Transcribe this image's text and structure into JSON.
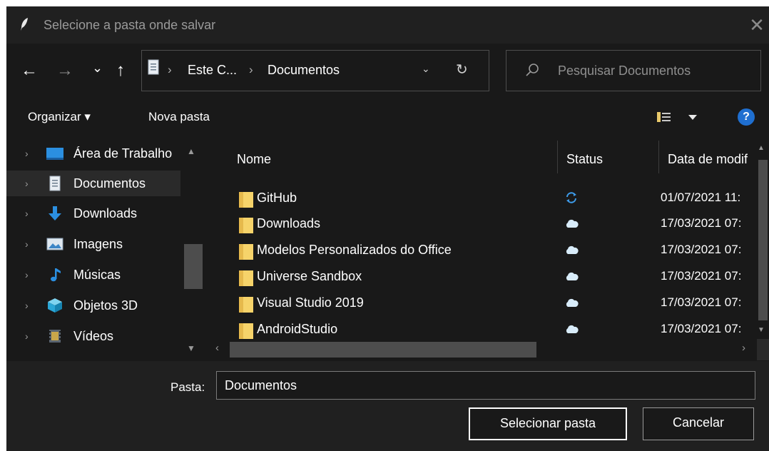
{
  "window": {
    "title": "Selecione a pasta onde salvar",
    "close_icon": "✕"
  },
  "nav": {
    "back_icon": "←",
    "forward_icon": "→",
    "recent_icon": "⌄",
    "up_icon": "↑"
  },
  "address": {
    "crumbs": [
      "Este C...",
      "Documentos"
    ],
    "separator": "›",
    "dropdown_icon": "⌄",
    "refresh_icon": "↻"
  },
  "search": {
    "placeholder": "Pesquisar Documentos"
  },
  "commandbar": {
    "organize_label": "Organizar ▾",
    "new_folder_label": "Nova pasta",
    "help_label": "?"
  },
  "navigation_pane": {
    "items": [
      {
        "label": "Área de Trabalho",
        "icon": "desktop-icon",
        "selected": false
      },
      {
        "label": "Documentos",
        "icon": "documents-icon",
        "selected": true
      },
      {
        "label": "Downloads",
        "icon": "downloads-icon",
        "selected": false
      },
      {
        "label": "Imagens",
        "icon": "pictures-icon",
        "selected": false
      },
      {
        "label": "Músicas",
        "icon": "music-icon",
        "selected": false
      },
      {
        "label": "Objetos 3D",
        "icon": "3d-objects-icon",
        "selected": false
      },
      {
        "label": "Vídeos",
        "icon": "videos-icon",
        "selected": false
      }
    ]
  },
  "file_list": {
    "columns": [
      "Nome",
      "Status",
      "Data de modif"
    ],
    "rows": [
      {
        "name": "GitHub",
        "status": "sync-icon",
        "date": "01/07/2021 11:"
      },
      {
        "name": "Downloads",
        "status": "cloud-icon",
        "date": "17/03/2021 07:"
      },
      {
        "name": "Modelos Personalizados do Office",
        "status": "cloud-icon",
        "date": "17/03/2021 07:"
      },
      {
        "name": "Universe Sandbox",
        "status": "cloud-icon",
        "date": "17/03/2021 07:"
      },
      {
        "name": "Visual Studio 2019",
        "status": "cloud-icon",
        "date": "17/03/2021 07:"
      },
      {
        "name": "AndroidStudio",
        "status": "cloud-icon",
        "date": "17/03/2021 07:"
      }
    ]
  },
  "footer": {
    "folder_label": "Pasta:",
    "folder_value": "Documentos",
    "select_button": "Selecionar pasta",
    "cancel_button": "Cancelar"
  },
  "colors": {
    "background": "#191919",
    "titlebar": "#202020",
    "folder": "#f6d36a",
    "accent": "#1f6fd0",
    "status_blue": "#3d9be9"
  }
}
